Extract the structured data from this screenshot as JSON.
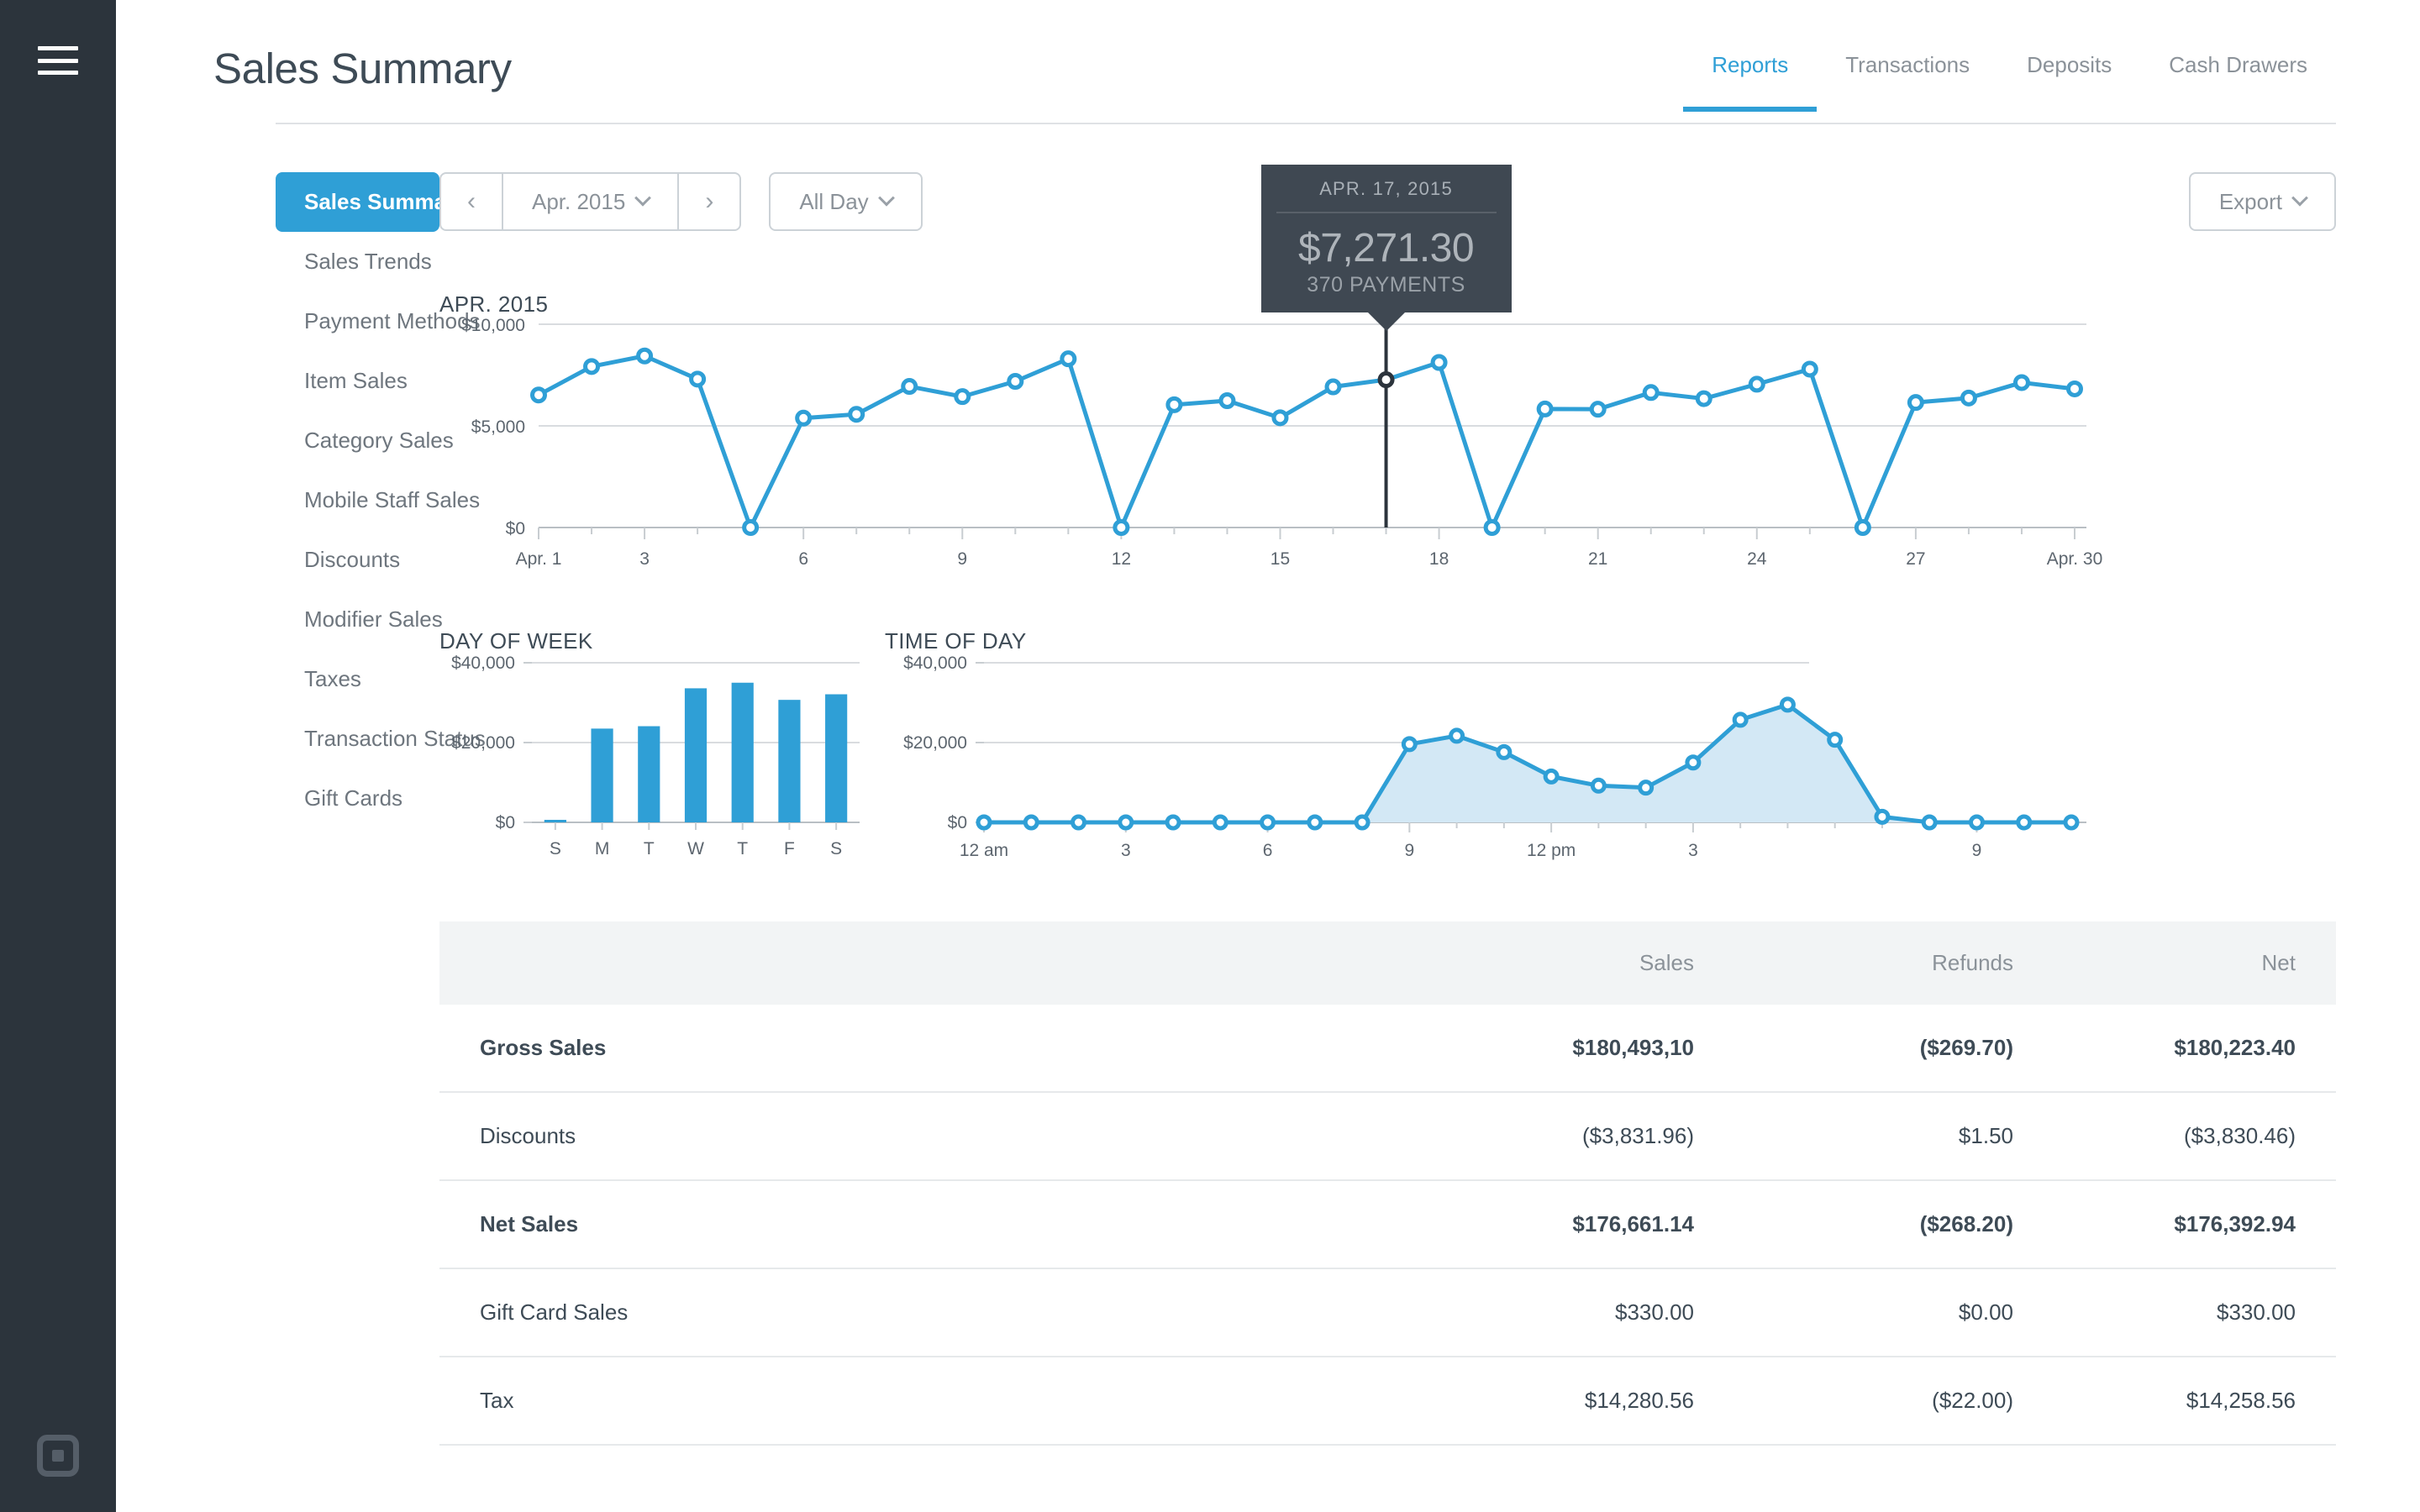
{
  "rail": {
    "menu_icon": "hamburger-icon",
    "logo_icon": "square-logo-icon"
  },
  "header": {
    "title": "Sales Summary",
    "tabs": [
      {
        "label": "Reports",
        "active": true
      },
      {
        "label": "Transactions",
        "active": false
      },
      {
        "label": "Deposits",
        "active": false
      },
      {
        "label": "Cash Drawers",
        "active": false
      }
    ]
  },
  "sidebar": {
    "items": [
      {
        "label": "Sales Summary",
        "active": true
      },
      {
        "label": "Sales Trends",
        "active": false
      },
      {
        "label": "Payment Methods",
        "active": false
      },
      {
        "label": "Item Sales",
        "active": false
      },
      {
        "label": "Category Sales",
        "active": false
      },
      {
        "label": "Mobile Staff Sales",
        "active": false
      },
      {
        "label": "Discounts",
        "active": false
      },
      {
        "label": "Modifier Sales",
        "active": false
      },
      {
        "label": "Taxes",
        "active": false
      },
      {
        "label": "Transaction Status",
        "active": false
      },
      {
        "label": "Gift Cards",
        "active": false
      }
    ]
  },
  "toolbar": {
    "prev_label": "‹",
    "next_label": "›",
    "period_label": "Apr. 2015",
    "daypart_label": "All Day",
    "export_label": "Export"
  },
  "tooltip": {
    "date": "APR. 17, 2015",
    "amount": "$7,271.30",
    "payments": "370 PAYMENTS"
  },
  "colors": {
    "accent": "#2f9fd6",
    "rail": "#2c343c",
    "tooltip_bg": "#3f4852",
    "area_fill": "#d3e8f5",
    "text_dark": "#3e4b56",
    "text_muted": "#8b9299"
  },
  "chart_data": [
    {
      "id": "monthly-sales",
      "type": "line",
      "title": "APR. 2015",
      "xlabel": "",
      "ylabel": "",
      "ylim": [
        0,
        10000
      ],
      "yticks": [
        0,
        5000,
        10000
      ],
      "ytick_labels": [
        "$0",
        "$5,000",
        "$10,000"
      ],
      "grid": true,
      "x": [
        1,
        2,
        3,
        4,
        5,
        6,
        7,
        8,
        9,
        10,
        11,
        12,
        13,
        14,
        15,
        16,
        17,
        18,
        19,
        20,
        21,
        22,
        23,
        24,
        25,
        26,
        27,
        28,
        29,
        30
      ],
      "xtick_values": [
        1,
        3,
        6,
        9,
        12,
        15,
        18,
        21,
        24,
        27,
        30
      ],
      "xtick_labels": [
        "Apr. 1",
        "3",
        "6",
        "9",
        "12",
        "15",
        "18",
        "21",
        "24",
        "27",
        "Apr. 30"
      ],
      "values": [
        6520,
        7920,
        8440,
        7300,
        0,
        5380,
        5570,
        6940,
        6440,
        7190,
        8300,
        0,
        6040,
        6240,
        5400,
        6920,
        7271.3,
        8120,
        0,
        5830,
        5820,
        6640,
        6340,
        7050,
        7790,
        0,
        6150,
        6370,
        7130,
        6820
      ],
      "highlight_index": 16,
      "highlight_label": "APR. 17, 2015"
    },
    {
      "id": "day-of-week",
      "type": "bar",
      "title": "DAY OF WEEK",
      "xlabel": "",
      "ylabel": "",
      "ylim": [
        0,
        40000
      ],
      "yticks": [
        0,
        20000,
        40000
      ],
      "ytick_labels": [
        "$0",
        "$20,000",
        "$40,000"
      ],
      "grid": true,
      "categories": [
        "S",
        "M",
        "T",
        "W",
        "T",
        "F",
        "S"
      ],
      "values": [
        450,
        23500,
        24100,
        33600,
        35000,
        30700,
        32100
      ]
    },
    {
      "id": "time-of-day",
      "type": "area",
      "title": "TIME OF DAY",
      "xlabel": "",
      "ylabel": "",
      "ylim": [
        0,
        40000
      ],
      "yticks": [
        0,
        20000,
        40000
      ],
      "ytick_labels": [
        "$0",
        "$20,000",
        "$40,000"
      ],
      "grid": true,
      "x": [
        0,
        1,
        2,
        3,
        4,
        5,
        6,
        7,
        8,
        9,
        10,
        11,
        12,
        13,
        14,
        15,
        16,
        17,
        18,
        19,
        20,
        21,
        22,
        23
      ],
      "xtick_values": [
        0,
        3,
        6,
        9,
        12,
        15,
        21
      ],
      "xtick_labels": [
        "12 am",
        "3",
        "6",
        "9",
        "12 pm",
        "3",
        "9"
      ],
      "values": [
        0,
        0,
        0,
        0,
        0,
        0,
        0,
        0,
        0,
        19600,
        21700,
        17600,
        11500,
        9200,
        8700,
        15000,
        25700,
        29500,
        20700,
        1400,
        0,
        0,
        0,
        0
      ]
    }
  ],
  "table": {
    "columns": [
      "",
      "Sales",
      "Refunds",
      "Net"
    ],
    "rows": [
      {
        "label": "Gross Sales",
        "sales": "$180,493,10",
        "refunds": "($269.70)",
        "net": "$180,223.40",
        "bold": true
      },
      {
        "label": "Discounts",
        "sales": "($3,831.96)",
        "refunds": "$1.50",
        "net": "($3,830.46)",
        "bold": false
      },
      {
        "label": "Net Sales",
        "sales": "$176,661.14",
        "refunds": "($268.20)",
        "net": "$176,392.94",
        "bold": true
      },
      {
        "label": "Gift Card Sales",
        "sales": "$330.00",
        "refunds": "$0.00",
        "net": "$330.00",
        "bold": false
      },
      {
        "label": "Tax",
        "sales": "$14,280.56",
        "refunds": "($22.00)",
        "net": "$14,258.56",
        "bold": false
      }
    ]
  }
}
